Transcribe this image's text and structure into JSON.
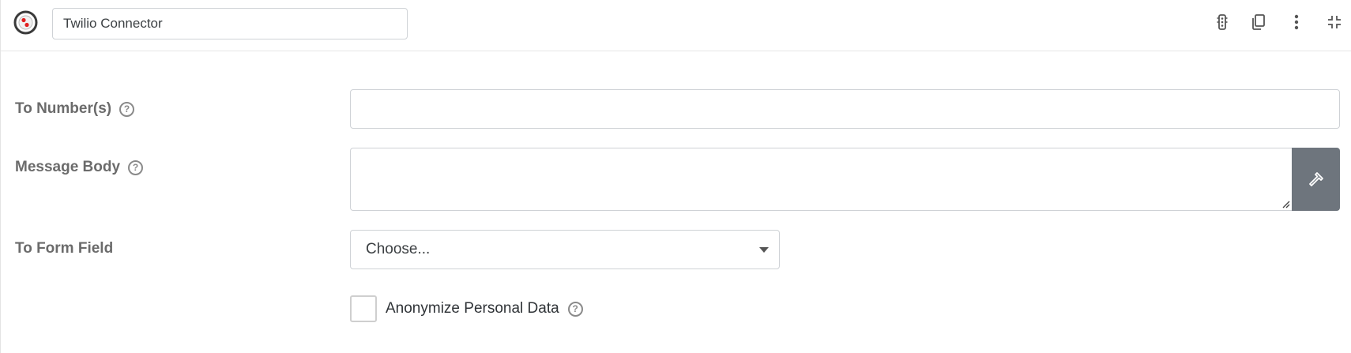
{
  "header": {
    "title_value": "Twilio Connector",
    "icons": [
      "logo-icon",
      "traffic-light-icon",
      "copy-icon",
      "more-vertical-icon",
      "collapse-icon"
    ]
  },
  "form": {
    "to_numbers": {
      "label": "To Number(s)",
      "value": ""
    },
    "message_body": {
      "label": "Message Body",
      "value": ""
    },
    "to_form_field": {
      "label": "To Form Field",
      "selected": "Choose..."
    },
    "anonymize": {
      "label": "Anonymize Personal Data",
      "checked": false
    }
  },
  "colors": {
    "merge_button": "#6e757d",
    "label": "#6b6b6b",
    "logo_dot": "#e02020"
  }
}
